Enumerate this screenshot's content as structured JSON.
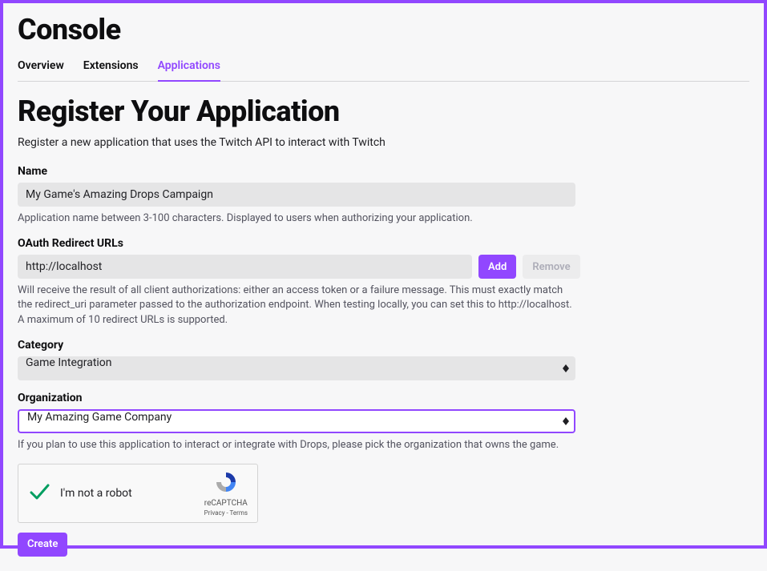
{
  "header": {
    "title": "Console"
  },
  "tabs": [
    {
      "label": "Overview",
      "active": false
    },
    {
      "label": "Extensions",
      "active": false
    },
    {
      "label": "Applications",
      "active": true
    }
  ],
  "page": {
    "title": "Register Your Application",
    "subtitle": "Register a new application that uses the Twitch API to interact with Twitch"
  },
  "form": {
    "name": {
      "label": "Name",
      "value": "My Game's Amazing Drops Campaign",
      "help": "Application name between 3-100 characters. Displayed to users when authorizing your application."
    },
    "oauth": {
      "label": "OAuth Redirect URLs",
      "value": "http://localhost",
      "add_label": "Add",
      "remove_label": "Remove",
      "help": "Will receive the result of all client authorizations: either an access token or a failure message. This must exactly match the redirect_uri parameter passed to the authorization endpoint. When testing locally, you can set this to http://localhost. A maximum of 10 redirect URLs is supported."
    },
    "category": {
      "label": "Category",
      "value": "Game Integration"
    },
    "organization": {
      "label": "Organization",
      "value": "My Amazing Game Company",
      "help": "If you plan to use this application to interact or integrate with Drops, please pick the organization that owns the game."
    },
    "recaptcha": {
      "label": "I'm not a robot",
      "brand": "reCAPTCHA",
      "legal": "Privacy - Terms"
    },
    "create_label": "Create"
  },
  "colors": {
    "accent": "#9147ff"
  }
}
